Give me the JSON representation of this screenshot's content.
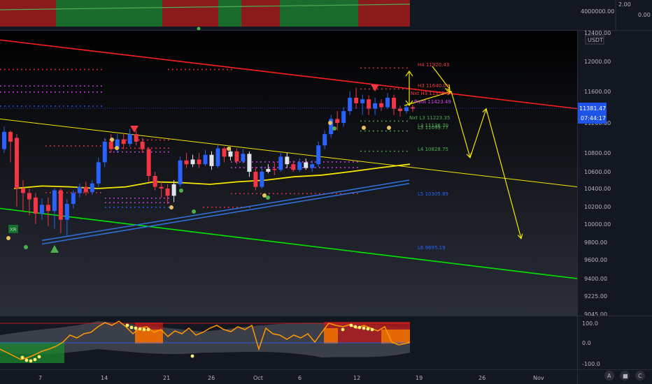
{
  "colors": {
    "background": "#131722",
    "up": "#2962ff",
    "down": "#f23645",
    "neutral": "#e0e3eb",
    "yellow": "#f5e600",
    "green": "#00e600",
    "red_line": "#ff1e1e",
    "blue_line": "#2f6fd6",
    "orange": "#ff9800",
    "price_tag": "#1e53e5"
  },
  "top_panel": {
    "axis_labels": [
      "4000000.00"
    ],
    "right_labels": [
      "2.00",
      "0.00"
    ]
  },
  "main_panel": {
    "currency": "USDT",
    "last_price": "11381.47",
    "countdown": "07:44:17",
    "pivot_labels": [
      {
        "text": "H4 11920.43",
        "color": "#f23645"
      },
      {
        "text": "H3 11640.01",
        "color": "#f23645"
      },
      {
        "text": "Nxt H3 11539.6",
        "color": "#f23645"
      },
      {
        "text": "Pivot 11423.49",
        "color": "#e040fb"
      },
      {
        "text": "Nxt L3 11223.35",
        "color": "#4caf50"
      },
      {
        "text": "L3 11136.70",
        "color": "#4caf50"
      },
      {
        "text": "L3 11099.77",
        "color": "#4caf50"
      },
      {
        "text": "L4 10828.75",
        "color": "#4caf50"
      },
      {
        "text": "L5 10305.89",
        "color": "#2962ff"
      },
      {
        "text": "L6 9695.19",
        "color": "#2962ff"
      }
    ],
    "xr_label": "XR"
  },
  "osc_panel": {
    "axis_labels": [
      "100.0",
      "0.0",
      "-100.0"
    ]
  },
  "time_axis": {
    "labels": [
      "7",
      "14",
      "21",
      "26",
      "Oct",
      "6",
      "12",
      "19",
      "26",
      "Nov"
    ]
  },
  "corner_buttons": [
    "A",
    "■",
    "C"
  ],
  "chart_data": {
    "type": "line",
    "title": "",
    "xlabel": "",
    "ylabel": "",
    "y_axis_ticks": [
      12400,
      12000,
      11600,
      11200,
      10800,
      10600,
      10400,
      10200,
      10000,
      9800,
      9600,
      9400,
      9225,
      9045
    ],
    "ylim": [
      9045,
      12400
    ],
    "x_labels": [
      "7",
      "14",
      "21",
      "26",
      "Oct",
      "6",
      "12",
      "19",
      "26",
      "Nov"
    ],
    "candles": [
      {
        "o": 10850,
        "c": 11080,
        "h": 11150,
        "l": 10800
      },
      {
        "o": 11080,
        "c": 10950,
        "h": 11100,
        "l": 10700
      },
      {
        "o": 11000,
        "c": 10400,
        "h": 11050,
        "l": 10200
      },
      {
        "o": 10400,
        "c": 10350,
        "h": 10500,
        "l": 10150
      },
      {
        "o": 10350,
        "c": 10280,
        "h": 10400,
        "l": 10100
      },
      {
        "o": 10300,
        "c": 10120,
        "h": 10350,
        "l": 10000
      },
      {
        "o": 10120,
        "c": 10220,
        "h": 10290,
        "l": 10050
      },
      {
        "o": 10220,
        "c": 10150,
        "h": 10300,
        "l": 9980
      },
      {
        "o": 10150,
        "c": 10380,
        "h": 10400,
        "l": 9950
      },
      {
        "o": 10380,
        "c": 10050,
        "h": 10400,
        "l": 9900
      },
      {
        "o": 10050,
        "c": 10230,
        "h": 10280,
        "l": 9870
      },
      {
        "o": 10230,
        "c": 10350,
        "h": 10380,
        "l": 10180
      },
      {
        "o": 10350,
        "c": 10420,
        "h": 10460,
        "l": 10300
      },
      {
        "o": 10420,
        "c": 10360,
        "h": 10480,
        "l": 10320
      },
      {
        "o": 10360,
        "c": 10460,
        "h": 10500,
        "l": 10330
      },
      {
        "o": 10460,
        "c": 10700,
        "h": 10750,
        "l": 10420
      },
      {
        "o": 10700,
        "c": 10950,
        "h": 11000,
        "l": 10650
      },
      {
        "o": 10950,
        "c": 10850,
        "h": 11050,
        "l": 10800
      },
      {
        "o": 10850,
        "c": 10980,
        "h": 11050,
        "l": 10800
      },
      {
        "o": 10980,
        "c": 10920,
        "h": 11060,
        "l": 10850
      },
      {
        "o": 10920,
        "c": 11050,
        "h": 11120,
        "l": 10880
      },
      {
        "o": 11050,
        "c": 10950,
        "h": 11100,
        "l": 10900
      },
      {
        "o": 10950,
        "c": 10850,
        "h": 11000,
        "l": 10800
      },
      {
        "o": 10850,
        "c": 10550,
        "h": 10880,
        "l": 10480
      },
      {
        "o": 10550,
        "c": 10420,
        "h": 10600,
        "l": 10380
      },
      {
        "o": 10420,
        "c": 10400,
        "h": 10480,
        "l": 10300
      },
      {
        "o": 10400,
        "c": 10320,
        "h": 10450,
        "l": 10230
      },
      {
        "o": 10320,
        "c": 10450,
        "h": 10500,
        "l": 10250
      },
      {
        "o": 10450,
        "c": 10720,
        "h": 10760,
        "l": 10420
      },
      {
        "o": 10720,
        "c": 10680,
        "h": 10800,
        "l": 10640
      },
      {
        "o": 10680,
        "c": 10730,
        "h": 10780,
        "l": 10650
      },
      {
        "o": 10730,
        "c": 10680,
        "h": 10800,
        "l": 10640
      },
      {
        "o": 10680,
        "c": 10780,
        "h": 10840,
        "l": 10660
      },
      {
        "o": 10780,
        "c": 10660,
        "h": 10820,
        "l": 10620
      },
      {
        "o": 10660,
        "c": 10860,
        "h": 10900,
        "l": 10640
      },
      {
        "o": 10860,
        "c": 10760,
        "h": 10880,
        "l": 10700
      },
      {
        "o": 10760,
        "c": 10820,
        "h": 10880,
        "l": 10720
      },
      {
        "o": 10820,
        "c": 10710,
        "h": 10860,
        "l": 10680
      },
      {
        "o": 10710,
        "c": 10790,
        "h": 10850,
        "l": 10690
      },
      {
        "o": 10790,
        "c": 10600,
        "h": 10820,
        "l": 10540
      },
      {
        "o": 10600,
        "c": 10420,
        "h": 10650,
        "l": 10380
      },
      {
        "o": 10420,
        "c": 10600,
        "h": 10660,
        "l": 10400
      },
      {
        "o": 10600,
        "c": 10630,
        "h": 10680,
        "l": 10580
      },
      {
        "o": 10630,
        "c": 10620,
        "h": 10700,
        "l": 10560
      },
      {
        "o": 10620,
        "c": 10760,
        "h": 10800,
        "l": 10600
      },
      {
        "o": 10760,
        "c": 10680,
        "h": 10800,
        "l": 10640
      },
      {
        "o": 10680,
        "c": 10620,
        "h": 10720,
        "l": 10600
      },
      {
        "o": 10620,
        "c": 10700,
        "h": 10740,
        "l": 10600
      },
      {
        "o": 10700,
        "c": 10640,
        "h": 10740,
        "l": 10620
      },
      {
        "o": 10640,
        "c": 10680,
        "h": 10720,
        "l": 10600
      },
      {
        "o": 10680,
        "c": 10900,
        "h": 10950,
        "l": 10650
      },
      {
        "o": 10900,
        "c": 11050,
        "h": 11100,
        "l": 10850
      },
      {
        "o": 11050,
        "c": 11250,
        "h": 11300,
        "l": 11000
      },
      {
        "o": 11250,
        "c": 11200,
        "h": 11350,
        "l": 11100
      },
      {
        "o": 11200,
        "c": 11350,
        "h": 11400,
        "l": 11150
      },
      {
        "o": 11350,
        "c": 11520,
        "h": 11600,
        "l": 11300
      },
      {
        "o": 11520,
        "c": 11450,
        "h": 11650,
        "l": 11380
      },
      {
        "o": 11450,
        "c": 11500,
        "h": 11560,
        "l": 11300
      },
      {
        "o": 11500,
        "c": 11380,
        "h": 11550,
        "l": 11300
      },
      {
        "o": 11380,
        "c": 11450,
        "h": 11520,
        "l": 11300
      },
      {
        "o": 11450,
        "c": 11400,
        "h": 11500,
        "l": 11350
      },
      {
        "o": 11400,
        "c": 11520,
        "h": 11580,
        "l": 11380
      },
      {
        "o": 11520,
        "c": 11380,
        "h": 11560,
        "l": 11300
      },
      {
        "o": 11380,
        "c": 11350,
        "h": 11420,
        "l": 11280
      },
      {
        "o": 11350,
        "c": 11400,
        "h": 11440,
        "l": 11320
      },
      {
        "o": 11400,
        "c": 11381,
        "h": 11430,
        "l": 11340
      }
    ],
    "lines": [
      {
        "name": "",
        "color": "#ff1e1e",
        "points": [
          [
            0,
            12300
          ],
          [
            825,
            11381
          ]
        ]
      },
      {
        "name": "",
        "color": "#00e600",
        "points": [
          [
            0,
            10180
          ],
          [
            825,
            9400
          ]
        ]
      },
      {
        "name": "",
        "color": "#f5e600",
        "points": [
          [
            0,
            11250
          ],
          [
            825,
            10420
          ]
        ]
      },
      {
        "name": "",
        "color": "#2f6fd6",
        "points": [
          [
            60,
            9820
          ],
          [
            585,
            10500
          ]
        ]
      },
      {
        "name": "",
        "color": "#2f6fd6",
        "points": [
          [
            60,
            9780
          ],
          [
            585,
            10460
          ]
        ]
      }
    ],
    "projection_points": [
      [
        578,
        11420
      ],
      [
        645,
        11600
      ],
      [
        672,
        10750
      ],
      [
        695,
        11380
      ],
      [
        745,
        9840
      ]
    ]
  }
}
